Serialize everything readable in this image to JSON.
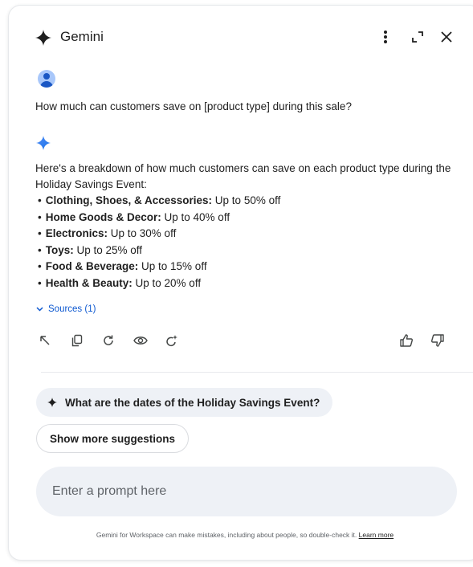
{
  "header": {
    "title": "Gemini",
    "icons": [
      "gemini-spark-icon",
      "more-vert-icon",
      "expand-icon",
      "close-icon"
    ]
  },
  "conversation": {
    "user_message": "How much can customers save on [product type] during this sale?",
    "response": {
      "intro": "Here's a breakdown of how much customers can save on each product type during the Holiday Savings Event:",
      "items": [
        {
          "label": "Clothing, Shoes, & Accessories:",
          "value": " Up to 50% off"
        },
        {
          "label": "Home Goods & Decor:",
          "value": " Up to 40% off"
        },
        {
          "label": "Electronics:",
          "value": " Up to 30% off"
        },
        {
          "label": "Toys:",
          "value": " Up to 25% off"
        },
        {
          "label": "Food & Beverage:",
          "value": " Up to 15% off"
        },
        {
          "label": "Health & Beauty:",
          "value": " Up to 20% off"
        }
      ],
      "bullet": "•",
      "sources_label": "Sources (1)"
    },
    "actions": [
      "insert-icon",
      "copy-icon",
      "retry-icon",
      "view-icon",
      "refine-icon",
      "thumbs-up-icon",
      "thumbs-down-icon"
    ]
  },
  "suggestions": {
    "chip": "What are the dates of the Holiday Savings Event?",
    "show_more": "Show more suggestions"
  },
  "prompt": {
    "placeholder": "Enter a prompt here"
  },
  "disclaimer": {
    "text": "Gemini for Workspace can make mistakes, including about people, so double-check it. ",
    "link": "Learn more"
  },
  "colors": {
    "accent_blue": "#1a73e8",
    "link_blue": "#0b57d0",
    "chip_bg": "#eef1f6"
  }
}
